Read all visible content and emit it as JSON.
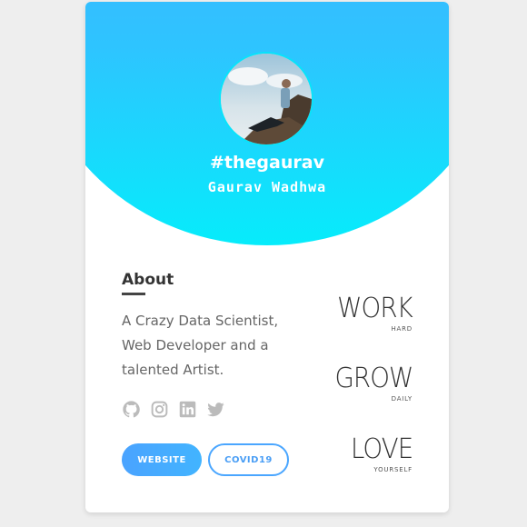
{
  "profile": {
    "handle": "#thegaurav",
    "name": "Gaurav Wadhwa"
  },
  "about": {
    "title": "About",
    "text": "A Crazy Data Scientist, Web Developer and a talented Artist."
  },
  "socials": [
    {
      "icon": "github-icon"
    },
    {
      "icon": "instagram-icon"
    },
    {
      "icon": "linkedin-icon"
    },
    {
      "icon": "twitter-icon"
    }
  ],
  "buttons": {
    "website": "WEBSITE",
    "covid": "COVID19"
  },
  "mottos": [
    {
      "word": "WORK",
      "sub": "HARD"
    },
    {
      "word": "GROW",
      "sub": "DAILY"
    },
    {
      "word": "LOVE",
      "sub": "YOURSELF"
    }
  ],
  "colors": {
    "gradient_top": "#4da7ff",
    "gradient_bottom": "#06ecfb",
    "accent": "#4aa6ff",
    "background": "#eeeeee"
  }
}
